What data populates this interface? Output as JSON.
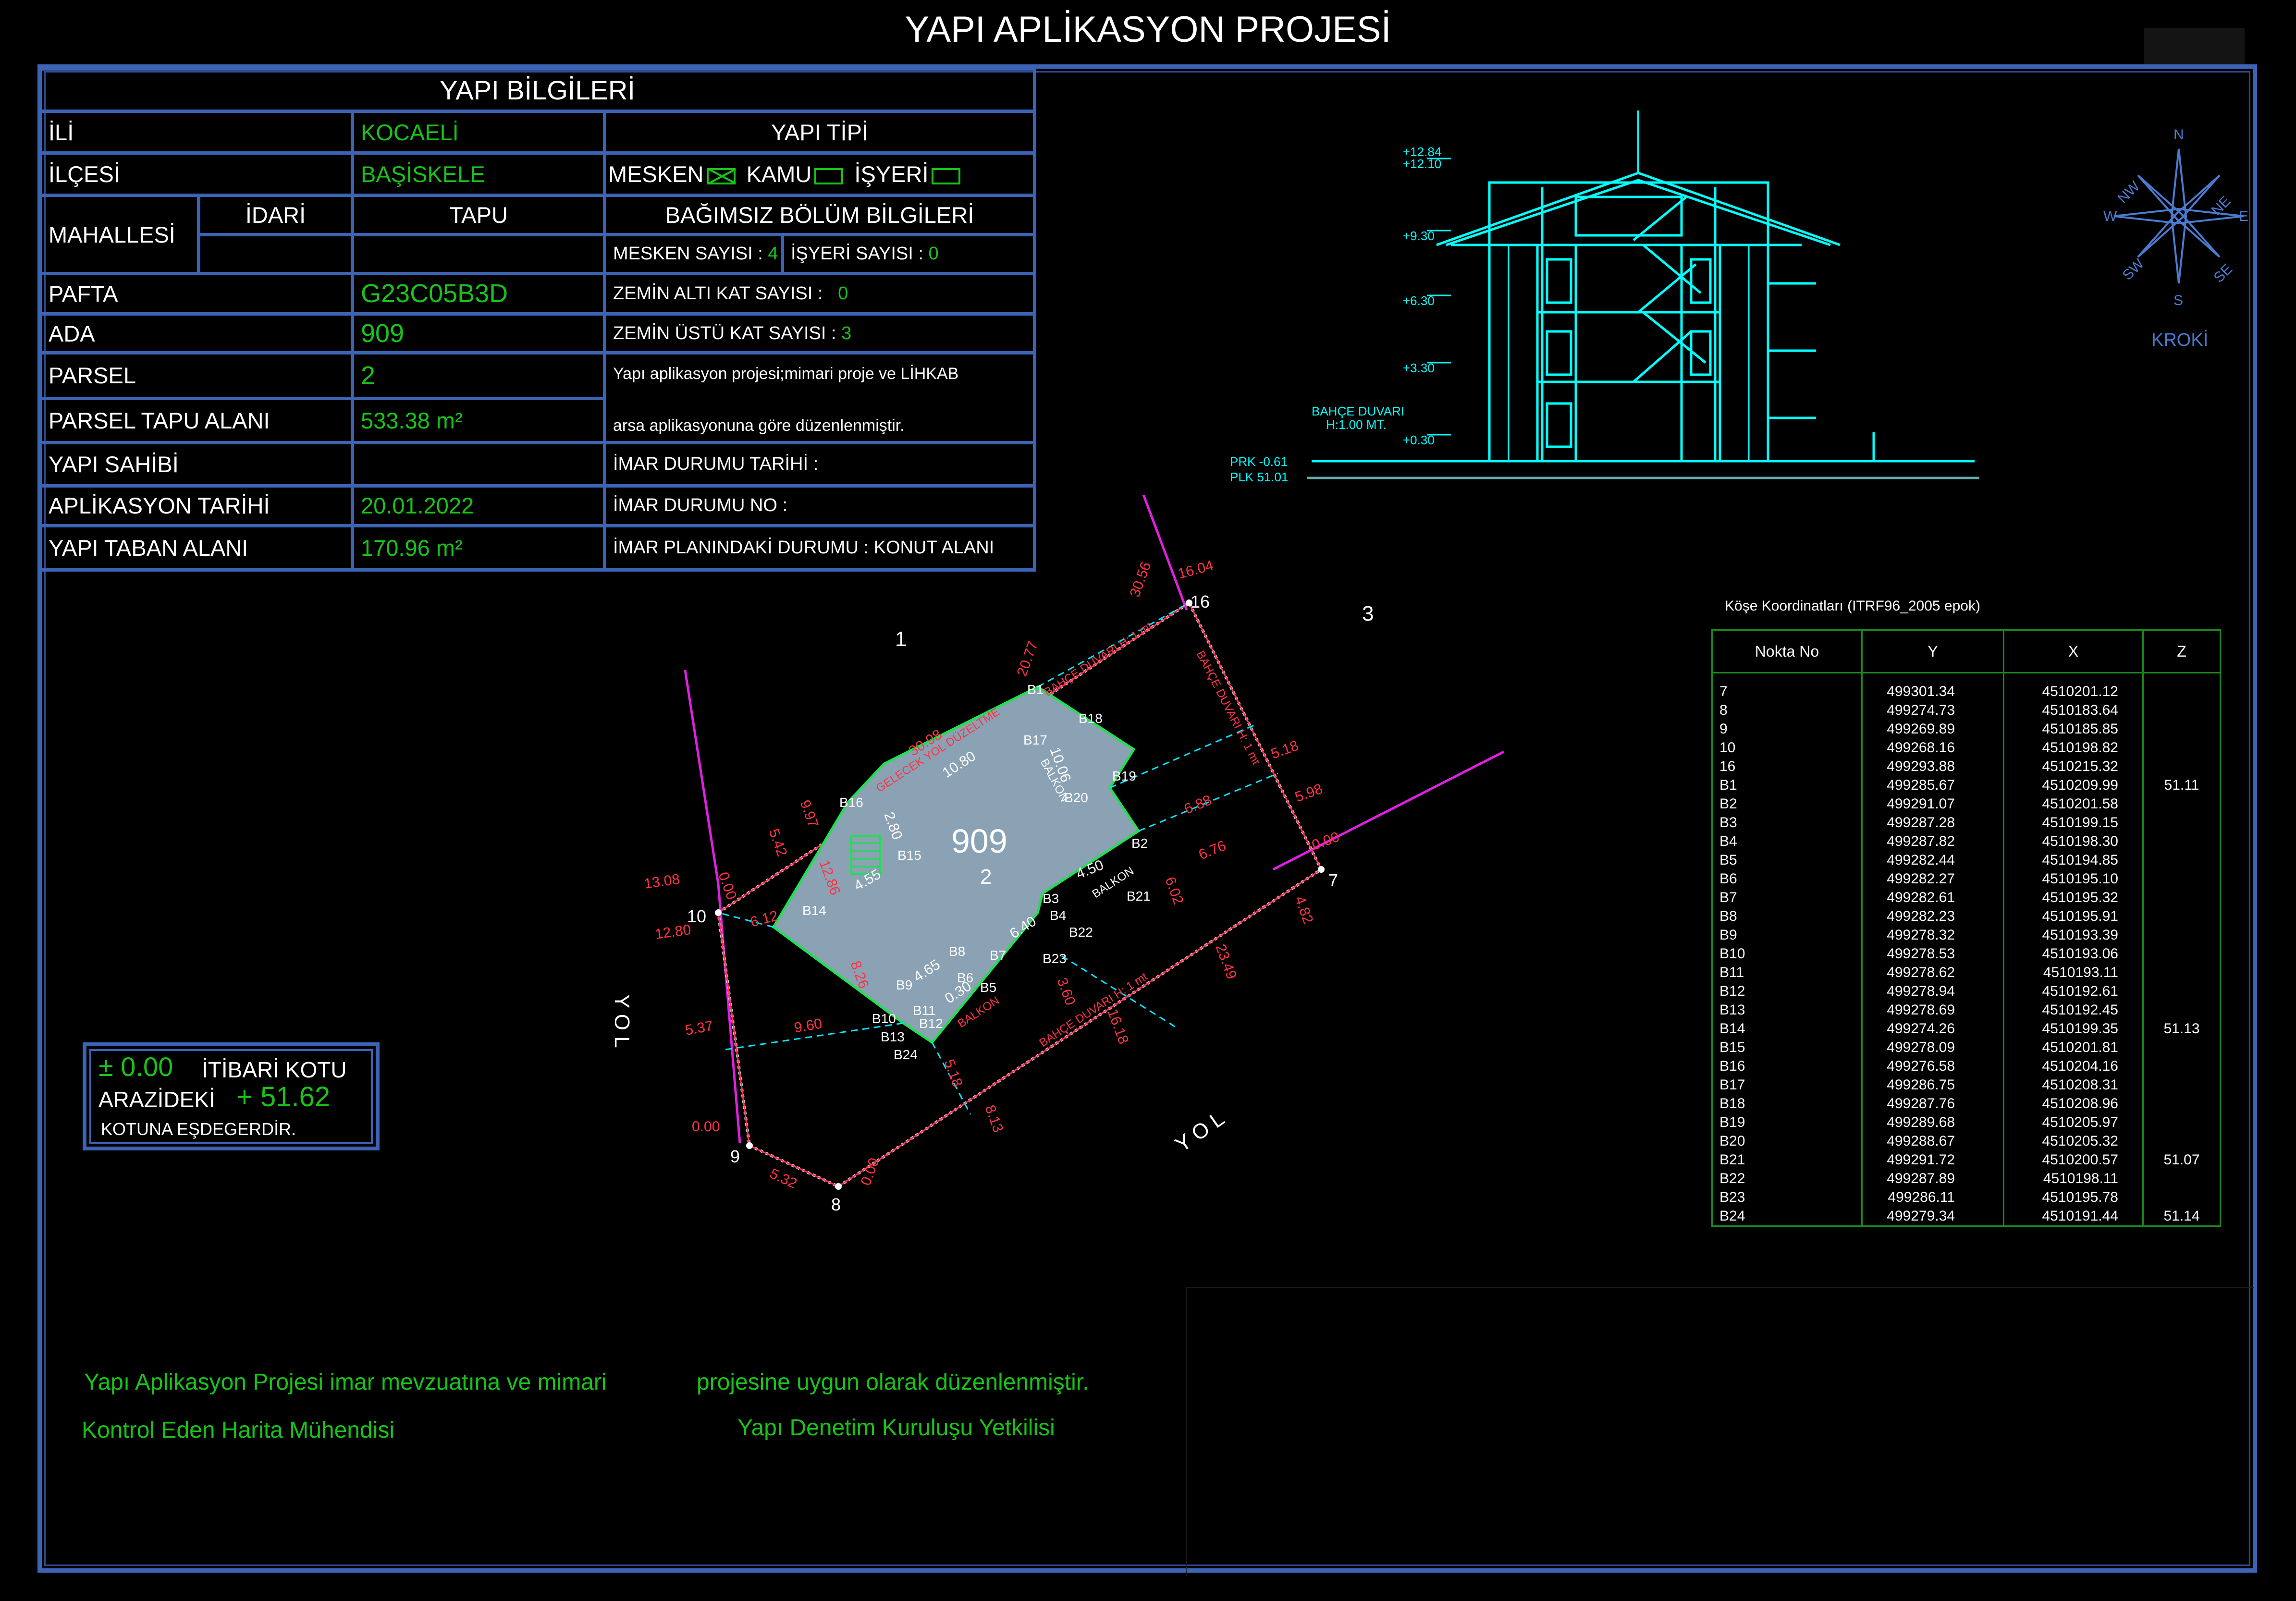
{
  "title": "YAPI APLİKASYON PROJESİ",
  "info": {
    "header": "YAPI BİLGİLERİ",
    "il_label": "İLİ",
    "il": "KOCAELİ",
    "ilce_label": "İLÇESİ",
    "ilce": "BAŞİSKELE",
    "mahalle_label": "MAHALLESİ",
    "idari_label": "İDARİ",
    "tapu_label": "TAPU",
    "pafta_label": "PAFTA",
    "pafta": "G23C05B3D",
    "ada_label": "ADA",
    "ada": "909",
    "parsel_label": "PARSEL",
    "parsel": "2",
    "alan_label": "PARSEL TAPU ALANI",
    "alan": "533.38 m²",
    "sahip_label": "YAPI SAHİBİ",
    "sahip": "",
    "tarih_label": "APLİKASYON TARİHİ",
    "tarih": "20.01.2022",
    "taban_label": "YAPI TABAN ALANI",
    "taban": "170.96  m²"
  },
  "yapi_tipi": {
    "header": "YAPI TİPİ",
    "mesken": "MESKEN",
    "kamu": "KAMU",
    "isyeri": "İŞYERİ",
    "bolum_header": "BAĞIMSIZ BÖLÜM BİLGİLERİ",
    "mesken_sayisi_label": "MESKEN SAYISI :",
    "mesken_sayisi": "4",
    "isyeri_sayisi_label": "İŞYERİ SAYISI :",
    "isyeri_sayisi": "0",
    "zemin_alti_label": "ZEMİN ALTI KAT SAYISI :",
    "zemin_alti": "0",
    "zemin_ustu_label": "ZEMİN ÜSTÜ KAT SAYISI :",
    "zemin_ustu": "3",
    "note1": "Yapı aplikasyon projesi;mimari proje ve LİHKAB",
    "note2": "arsa aplikasyonuna göre düzenlenmiştir.",
    "imar_tarih_label": "İMAR DURUMU TARİHİ :",
    "imar_no_label": "İMAR DURUMU NO :",
    "imar_plan_label": "İMAR PLANINDAKİ DURUMU :",
    "imar_plan": "KONUT ALANI"
  },
  "section": {
    "levels": [
      "+12.84",
      "+12.10",
      "+9.30",
      "+6.30",
      "+3.30",
      "+0.30"
    ],
    "garden_wall": "BAHÇE DUVARI",
    "garden_wall_h": "H:1.00 MT.",
    "prk": "PRK  -0.61",
    "plk": "PLK   51.01"
  },
  "compass": {
    "n": "N",
    "s": "S",
    "e": "E",
    "w": "W",
    "ne": "NE",
    "nw": "NW",
    "se": "SE",
    "sw": "SW",
    "label": "KROKİ"
  },
  "coord": {
    "title": "Köşe Koordinatları (ITRF96_2005 epok)",
    "headers": [
      "Nokta   No",
      "Y",
      "X",
      "Z"
    ],
    "rows": [
      [
        "7",
        "499301.34",
        "4510201.12",
        ""
      ],
      [
        "8",
        "499274.73",
        "4510183.64",
        ""
      ],
      [
        "9",
        "499269.89",
        "4510185.85",
        ""
      ],
      [
        "10",
        "499268.16",
        "4510198.82",
        ""
      ],
      [
        "16",
        "499293.88",
        "4510215.32",
        ""
      ],
      [
        "B1",
        "499285.67",
        "4510209.99",
        "51.11"
      ],
      [
        "B2",
        "499291.07",
        "4510201.58",
        ""
      ],
      [
        "B3",
        "499287.28",
        "4510199.15",
        ""
      ],
      [
        "B4",
        "499287.82",
        "4510198.30",
        ""
      ],
      [
        "B5",
        "499282.44",
        "4510194.85",
        ""
      ],
      [
        "B6",
        "499282.27",
        "4510195.10",
        ""
      ],
      [
        "B7",
        "499282.61",
        "4510195.32",
        ""
      ],
      [
        "B8",
        "499282.23",
        "4510195.91",
        ""
      ],
      [
        "B9",
        "499278.32",
        "4510193.39",
        ""
      ],
      [
        "B10",
        "499278.53",
        "4510193.06",
        ""
      ],
      [
        "B11",
        "499278.62",
        "4510193.11",
        ""
      ],
      [
        "B12",
        "499278.94",
        "4510192.61",
        ""
      ],
      [
        "B13",
        "499278.69",
        "4510192.45",
        ""
      ],
      [
        "B14",
        "499274.26",
        "4510199.35",
        "51.13"
      ],
      [
        "B15",
        "499278.09",
        "4510201.81",
        ""
      ],
      [
        "B16",
        "499276.58",
        "4510204.16",
        ""
      ],
      [
        "B17",
        "499286.75",
        "4510208.31",
        ""
      ],
      [
        "B18",
        "499287.76",
        "4510208.96",
        ""
      ],
      [
        "B19",
        "499289.68",
        "4510205.97",
        ""
      ],
      [
        "B20",
        "499288.67",
        "4510205.32",
        ""
      ],
      [
        "B21",
        "499291.72",
        "4510200.57",
        "51.07"
      ],
      [
        "B22",
        "499287.89",
        "4510198.11",
        ""
      ],
      [
        "B23",
        "499286.11",
        "4510195.78",
        ""
      ],
      [
        "B24",
        "499279.34",
        "4510191.44",
        "51.14"
      ]
    ]
  },
  "plan": {
    "ada": "909",
    "parsel": "2",
    "neighbor_1": "1",
    "neighbor_3": "3",
    "road_1": "Y O L",
    "road_2": "Y O L",
    "points": [
      "7",
      "8",
      "9",
      "10",
      "16"
    ],
    "building_points": [
      "B1",
      "B2",
      "B3",
      "B4",
      "B5",
      "B6",
      "B7",
      "B8",
      "B9",
      "B10",
      "B11",
      "B12",
      "B13",
      "B14",
      "B15",
      "B16",
      "B17",
      "B18",
      "B19",
      "B20",
      "B21",
      "B22",
      "B23",
      "B24"
    ],
    "dims": [
      "30.98",
      "10.80",
      "20.77",
      "30.56",
      "16.04",
      "5.18",
      "5.98",
      "0.00",
      "4.82",
      "23.49",
      "6.88",
      "6.76",
      "4.50",
      "6.02",
      "6.40",
      "4.65",
      "0.30",
      "5.37",
      "9.60",
      "0.00",
      "5.32",
      "0.00",
      "8.13",
      "5.18",
      "16.18",
      "2.80",
      "12.86",
      "4.55",
      "6.12",
      "13.08",
      "12.80",
      "0.00",
      "9.97",
      "5.42",
      "10.06",
      "8.26",
      "3.60"
    ],
    "labels": {
      "balkon": "BALKON",
      "wall": "BAHÇE DUVARI H: 1 mt",
      "setback": "GELECEK YOL DÜZELTME"
    }
  },
  "elevation": {
    "line1_a": "± 0.00",
    "line1_b": "İTİBARİ KOTU",
    "line2_a": "ARAZİDEKİ",
    "line2_b": "+ 51.62",
    "line3": "KOTUNA EŞDEGERDİR."
  },
  "footer": {
    "line1a": "Yapı Aplikasyon Projesi imar mevzuatına ve mimari",
    "line1b": "projesine uygun olarak düzenlenmiştir.",
    "sig1": "Kontrol Eden Harita Mühendisi",
    "sig2": "Yapı Denetim Kuruluşu Yetkilisi"
  }
}
